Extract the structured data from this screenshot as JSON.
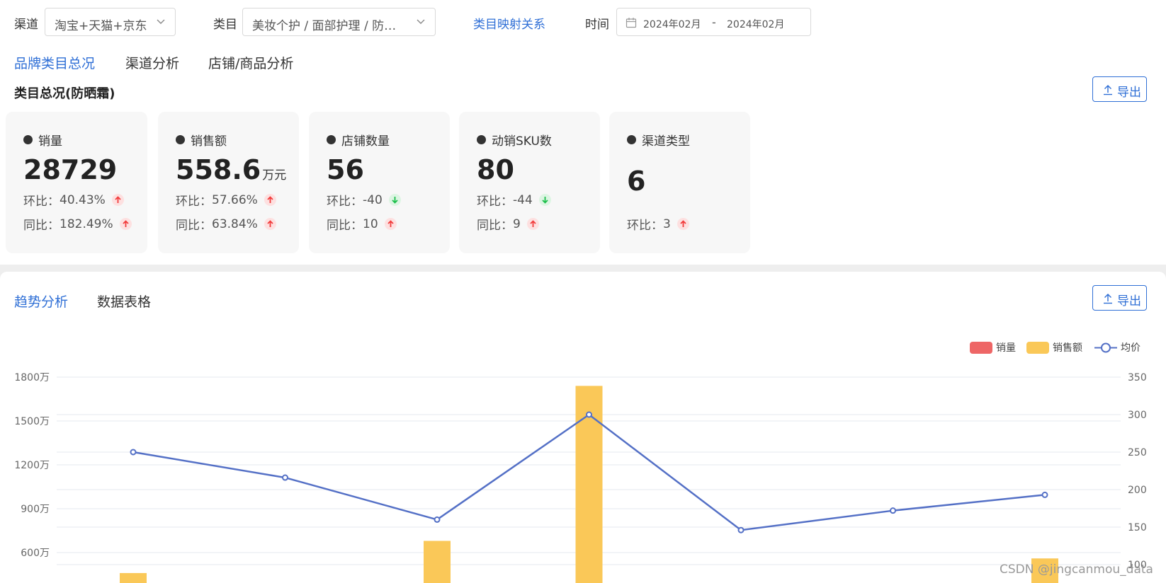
{
  "filters": {
    "channel": {
      "label": "渠道",
      "value": "淘宝+天猫+京东"
    },
    "category": {
      "label": "类目",
      "value": "美妆个护 / 面部护理 / 防…"
    },
    "mapping_link": "类目映射关系",
    "time": {
      "label": "时间",
      "start": "2024年02月",
      "separator": "-",
      "end": "2024年02月"
    }
  },
  "tabs": [
    {
      "label": "品牌类目总况",
      "active": true
    },
    {
      "label": "渠道分析",
      "active": false
    },
    {
      "label": "店铺/商品分析",
      "active": false
    }
  ],
  "section_title": "类目总况(防晒霜)",
  "export_label": "导出",
  "kpis": [
    {
      "name": "销量",
      "value": "28729",
      "unit": "",
      "rows": [
        {
          "label": "环比：",
          "val": "40.43%",
          "dir": "up"
        },
        {
          "label": "同比：",
          "val": "182.49%",
          "dir": "up"
        }
      ]
    },
    {
      "name": "销售额",
      "value": "558.6",
      "unit": "万元",
      "rows": [
        {
          "label": "环比：",
          "val": "57.66%",
          "dir": "up"
        },
        {
          "label": "同比：",
          "val": "63.84%",
          "dir": "up"
        }
      ]
    },
    {
      "name": "店铺数量",
      "value": "56",
      "unit": "",
      "rows": [
        {
          "label": "环比：",
          "val": "-40",
          "dir": "down"
        },
        {
          "label": "同比：",
          "val": "10",
          "dir": "up"
        }
      ]
    },
    {
      "name": "动销SKU数",
      "value": "80",
      "unit": "",
      "rows": [
        {
          "label": "环比：",
          "val": "-44",
          "dir": "down"
        },
        {
          "label": "同比：",
          "val": "9",
          "dir": "up"
        }
      ]
    },
    {
      "name": "渠道类型",
      "value": "6",
      "unit": "",
      "rows": [
        {
          "label": "环比：",
          "val": "3",
          "dir": "up"
        }
      ]
    }
  ],
  "bottom_tabs": [
    {
      "label": "趋势分析",
      "active": true
    },
    {
      "label": "数据表格",
      "active": false
    }
  ],
  "colors": {
    "accent": "#2f6fd6",
    "up": "#f23d3d",
    "down": "#1bbf4a",
    "sales_volume": "#ee6666",
    "sales_amount": "#fac858",
    "avg_price": "#5470c6"
  },
  "chart_data": {
    "type": "bar",
    "legend": [
      "销量",
      "销售额",
      "均价"
    ],
    "legend_position": "top-right",
    "y_left": {
      "ticks": [
        "600万",
        "900万",
        "1200万",
        "1500万",
        "1800万"
      ],
      "range": [
        600,
        1800
      ]
    },
    "y_right": {
      "ticks": [
        "100",
        "150",
        "200",
        "250",
        "300",
        "350"
      ],
      "range": [
        100,
        350
      ]
    },
    "grid": true,
    "series": [
      {
        "name": "销售额",
        "type": "bar",
        "axis": "left",
        "values": [
          460,
          null,
          680,
          1740,
          null,
          null,
          560
        ]
      },
      {
        "name": "均价",
        "type": "line",
        "axis": "right",
        "values": [
          250,
          216,
          160,
          300,
          146,
          172,
          193
        ]
      }
    ]
  },
  "watermark": "CSDN @jingcanmou_data"
}
